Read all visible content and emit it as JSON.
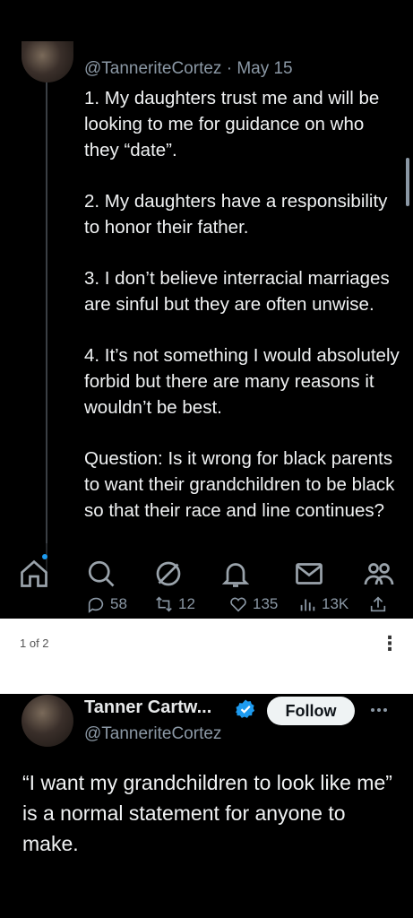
{
  "top_tweet": {
    "handle": "@TanneriteCortez",
    "separator": "·",
    "date": "May 15",
    "paragraphs": [
      "1. My daughters trust me and will be looking to me for guidance on who they “date”.",
      "2. My daughters have a responsibility to honor their father.",
      "3. I don’t believe interracial marriages are sinful but they are often unwise.",
      "4. It’s not something I would absolutely forbid but there are many reasons it wouldn’t be best.",
      "Question: Is it wrong for black parents to want their grandchildren to be black so that their race and line continues?"
    ],
    "actions": {
      "replies": "58",
      "reposts": "12",
      "likes": "135",
      "views": "13K"
    }
  },
  "bottom_nav": {
    "items": [
      "home-icon",
      "search-icon",
      "grok-icon",
      "notifications-icon",
      "messages-icon",
      "communities-icon"
    ],
    "accent": "#1d9bf0"
  },
  "page_bar": {
    "count": "1 of 2",
    "menu_icon": "more-vertical-icon"
  },
  "bottom_tweet": {
    "name": "Tanner Cartw...",
    "handle": "@TanneriteCortez",
    "follow_label": "Follow",
    "body": "“I want my grandchildren to look like me” is a normal statement for anyone to make."
  },
  "colors": {
    "background": "#000000",
    "text": "#e7e9ea",
    "muted": "#8b98a5",
    "verified": "#1d9bf0"
  }
}
